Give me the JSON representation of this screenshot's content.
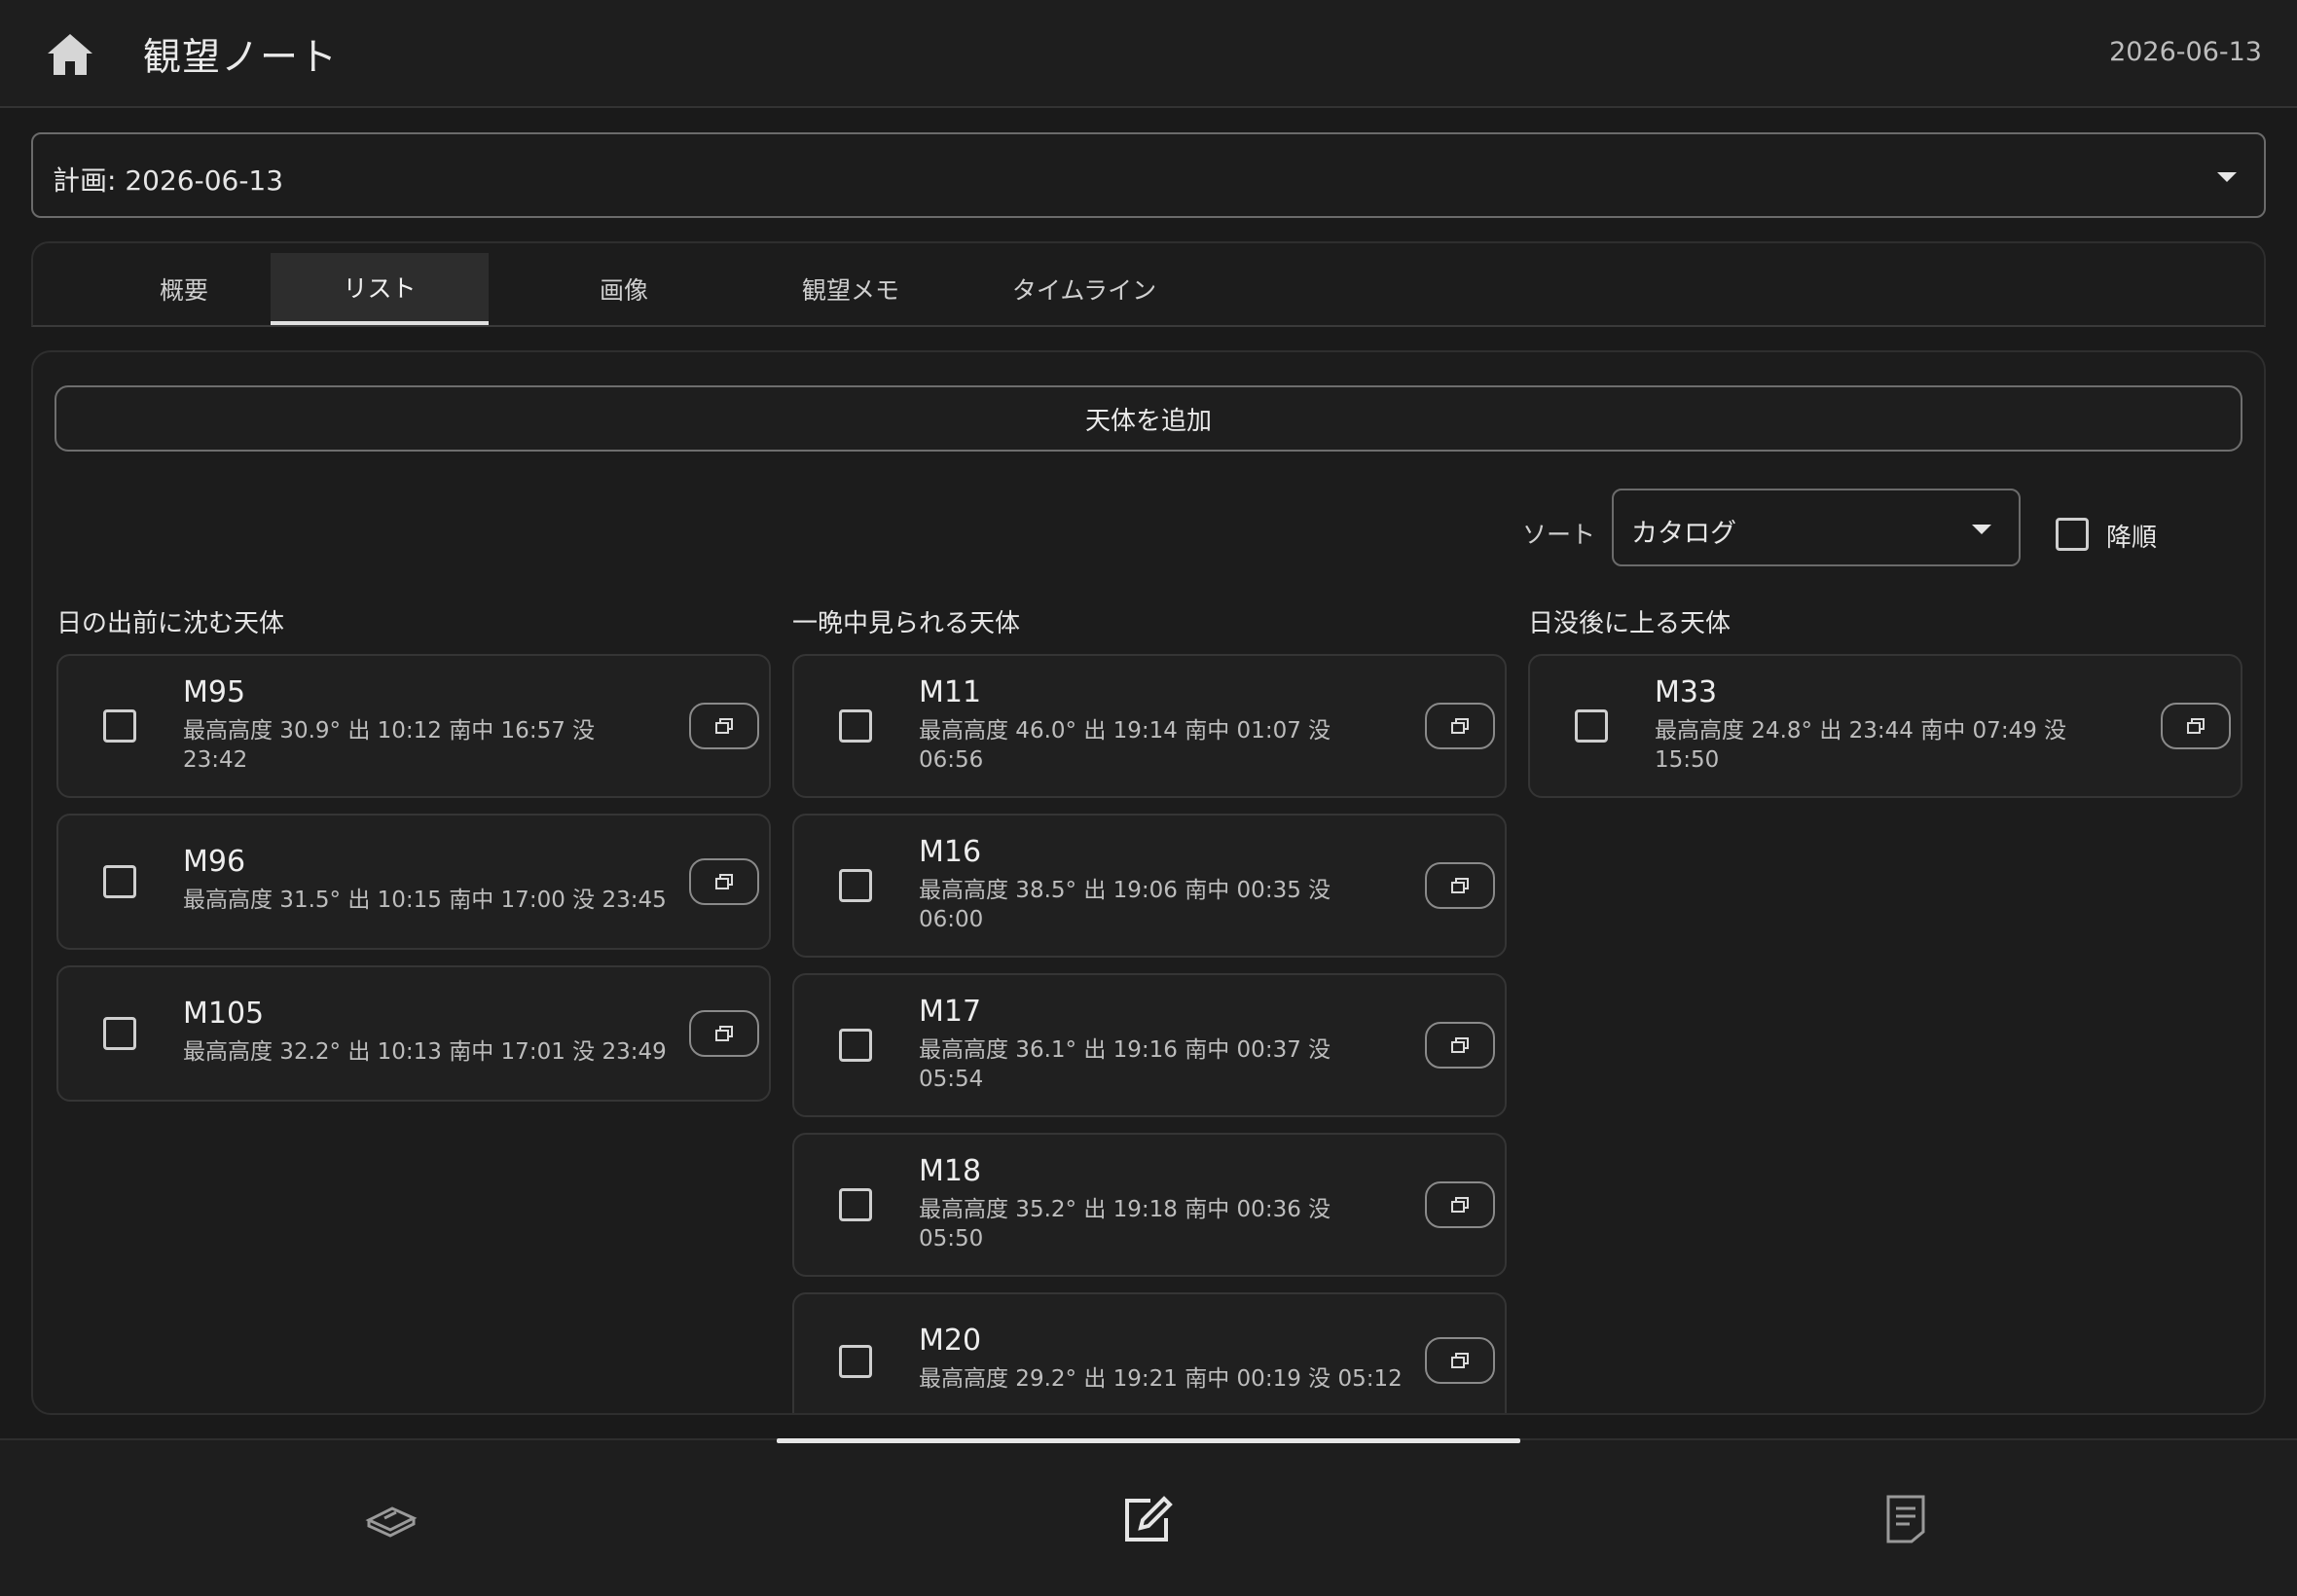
{
  "header": {
    "title": "観望ノート",
    "date": "2026-06-13"
  },
  "plan_select": {
    "value": "計画: 2026-06-13"
  },
  "tabs": [
    {
      "label": "概要",
      "active": false
    },
    {
      "label": "リスト",
      "active": true
    },
    {
      "label": "画像",
      "active": false
    },
    {
      "label": "観望メモ",
      "active": false
    },
    {
      "label": "タイムライン",
      "active": false
    }
  ],
  "toolbar": {
    "add_label": "天体を追加",
    "sort_label": "ソート",
    "sort_value": "カタログ",
    "descending_label": "降順",
    "descending_checked": false
  },
  "columns": [
    {
      "title": "日の出前に沈む天体",
      "items": [
        {
          "name": "M95",
          "meta": "最高高度 30.9°  出 10:12  南中 16:57  没 23:42"
        },
        {
          "name": "M96",
          "meta": "最高高度 31.5°  出 10:15  南中 17:00  没 23:45"
        },
        {
          "name": "M105",
          "meta": "最高高度 32.2°  出 10:13  南中 17:01  没 23:49"
        }
      ]
    },
    {
      "title": "一晩中見られる天体",
      "items": [
        {
          "name": "M11",
          "meta": "最高高度 46.0°  出 19:14  南中 01:07  没 06:56"
        },
        {
          "name": "M16",
          "meta": "最高高度 38.5°  出 19:06  南中 00:35  没 06:00"
        },
        {
          "name": "M17",
          "meta": "最高高度 36.1°  出 19:16  南中 00:37  没 05:54"
        },
        {
          "name": "M18",
          "meta": "最高高度 35.2°  出 19:18  南中 00:36  没 05:50"
        },
        {
          "name": "M20",
          "meta": "最高高度 29.2°  出 19:21  南中 00:19  没 05:12"
        }
      ]
    },
    {
      "title": "日没後に上る天体",
      "items": [
        {
          "name": "M33",
          "meta": "最高高度 24.8°  出 23:44  南中 07:49  没 15:50"
        }
      ]
    }
  ],
  "bottom_nav": [
    {
      "icon": "book-stack-icon",
      "active": false
    },
    {
      "icon": "edit-note-icon",
      "active": true
    },
    {
      "icon": "document-list-icon",
      "active": false
    }
  ]
}
